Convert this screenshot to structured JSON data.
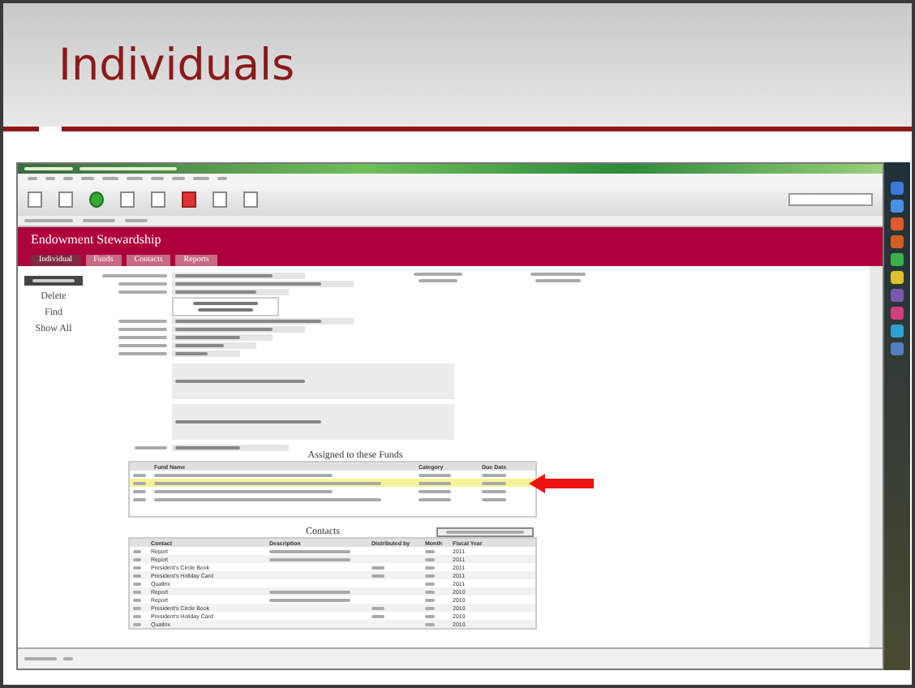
{
  "slide": {
    "title": "Individuals"
  },
  "app": {
    "banner_title": "Endowment Stewardship",
    "tabs": [
      {
        "label": "Individual",
        "selected": true
      },
      {
        "label": "Funds",
        "selected": false
      },
      {
        "label": "Contacts",
        "selected": false
      },
      {
        "label": "Reports",
        "selected": false
      }
    ],
    "side_actions": [
      "Delete",
      "Find",
      "Show All"
    ],
    "funds": {
      "title": "Assigned to these Funds",
      "columns": [
        "Fund Name",
        "Category",
        "Due Date"
      ],
      "rows": [
        {
          "selected": false
        },
        {
          "selected": true
        },
        {
          "selected": false
        },
        {
          "selected": false
        }
      ]
    },
    "contacts": {
      "title": "Contacts",
      "columns": [
        "Contact",
        "Description",
        "Distributed by",
        "Month",
        "Fiscal Year"
      ],
      "rows": [
        {
          "contact": "Report",
          "fiscal_year": "2011"
        },
        {
          "contact": "Report",
          "fiscal_year": "2011"
        },
        {
          "contact": "President's Circle Book",
          "fiscal_year": "2011"
        },
        {
          "contact": "President's Holiday Card",
          "fiscal_year": "2011"
        },
        {
          "contact": "Qualtrix",
          "fiscal_year": "2011"
        },
        {
          "contact": "Report",
          "fiscal_year": "2010"
        },
        {
          "contact": "Report",
          "fiscal_year": "2010"
        },
        {
          "contact": "President's Circle Book",
          "fiscal_year": "2010"
        },
        {
          "contact": "President's Holiday Card",
          "fiscal_year": "2010"
        },
        {
          "contact": "Qualtrix",
          "fiscal_year": "2010"
        }
      ]
    }
  }
}
